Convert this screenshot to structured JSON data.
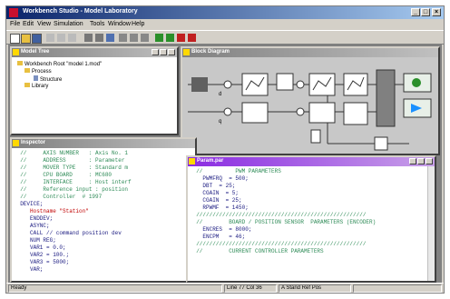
{
  "window": {
    "title": "Workbench Studio - Model Laboratory"
  },
  "menu": [
    "File",
    "Edit",
    "View",
    "Simulation",
    "Tools",
    "Window",
    "Help"
  ],
  "tree_window": {
    "title": "Model Tree",
    "items": [
      "Workbench Root \"model 1.mod\"",
      "Process",
      "Structure",
      "Library"
    ]
  },
  "editor1": {
    "title": "Inspector",
    "lines": [
      {
        "text": "  //     AXIS NUMBER   : Axis No. 1",
        "kind": "comment"
      },
      {
        "text": "  //     ADDRESS       : Parameter",
        "kind": "comment"
      },
      {
        "text": "  //     MOVER TYPE    : Standard m",
        "kind": "comment"
      },
      {
        "text": "  //     CPU BOARD     : MC680",
        "kind": "comment"
      },
      {
        "text": "  //     INTERFACE     : Host interf",
        "kind": "comment"
      },
      {
        "text": "  //     Reference input : position",
        "kind": "comment"
      },
      {
        "text": "  //     Controller  # 1997",
        "kind": "comment"
      },
      {
        "text": "  DEVICE;",
        "kind": "norm"
      },
      {
        "text": "     Hostname \"Station\"",
        "kind": "str"
      },
      {
        "text": "     ENDDEV;",
        "kind": "norm"
      },
      {
        "text": "     ASYNC;",
        "kind": "norm"
      },
      {
        "text": "     CALL // command position dev",
        "kind": "norm"
      },
      {
        "text": "     NUM REG;",
        "kind": "norm"
      },
      {
        "text": "     VAR1 = 0.0;",
        "kind": "norm"
      },
      {
        "text": "     VAR2 = 100.;",
        "kind": "norm"
      },
      {
        "text": "     VAR3 = 5000;",
        "kind": "norm"
      },
      {
        "text": "     VAR;",
        "kind": "norm"
      }
    ]
  },
  "editor2": {
    "title": "Param.par",
    "lines": [
      {
        "text": "  //          PWM PARAMETERS",
        "kind": "comment"
      },
      {
        "text": "    PWMFRQ  = 500;",
        "kind": "norm"
      },
      {
        "text": "    DBT  = 25;",
        "kind": "norm"
      },
      {
        "text": "    CGAIN  = 5;",
        "kind": "norm"
      },
      {
        "text": "    CGAIN  = 25;",
        "kind": "norm"
      },
      {
        "text": "    RPWMF  = 1450;",
        "kind": "norm"
      },
      {
        "text": "  ////////////////////////////////////////////////////",
        "kind": "comment"
      },
      {
        "text": "  //        BOARD / POSITION SENSOR  PARAMETERS (ENCODER)",
        "kind": "comment"
      },
      {
        "text": "    ENCRES  = 8000;",
        "kind": "norm"
      },
      {
        "text": "    ENCPM   = 46;",
        "kind": "norm"
      },
      {
        "text": "  ////////////////////////////////////////////////////",
        "kind": "comment"
      },
      {
        "text": "  //        CURRENT CONTROLLER PARAMETERS",
        "kind": "comment"
      }
    ]
  },
  "diagram": {
    "title": "Block Diagram",
    "blocks": [
      "PI",
      "PI",
      "PI",
      "PI",
      "PI",
      "PI",
      "M",
      "=",
      "MC"
    ],
    "signals": [
      "d",
      "q"
    ]
  },
  "status": {
    "left": "Ready",
    "pos": "Line 77 Col 36",
    "mode": "A Stand Ref Pos",
    "extra": ""
  },
  "colors": {
    "accent": "#0a246a",
    "active_title": "#8a2be2",
    "comment": "#2e8b57",
    "string": "#c00000"
  }
}
